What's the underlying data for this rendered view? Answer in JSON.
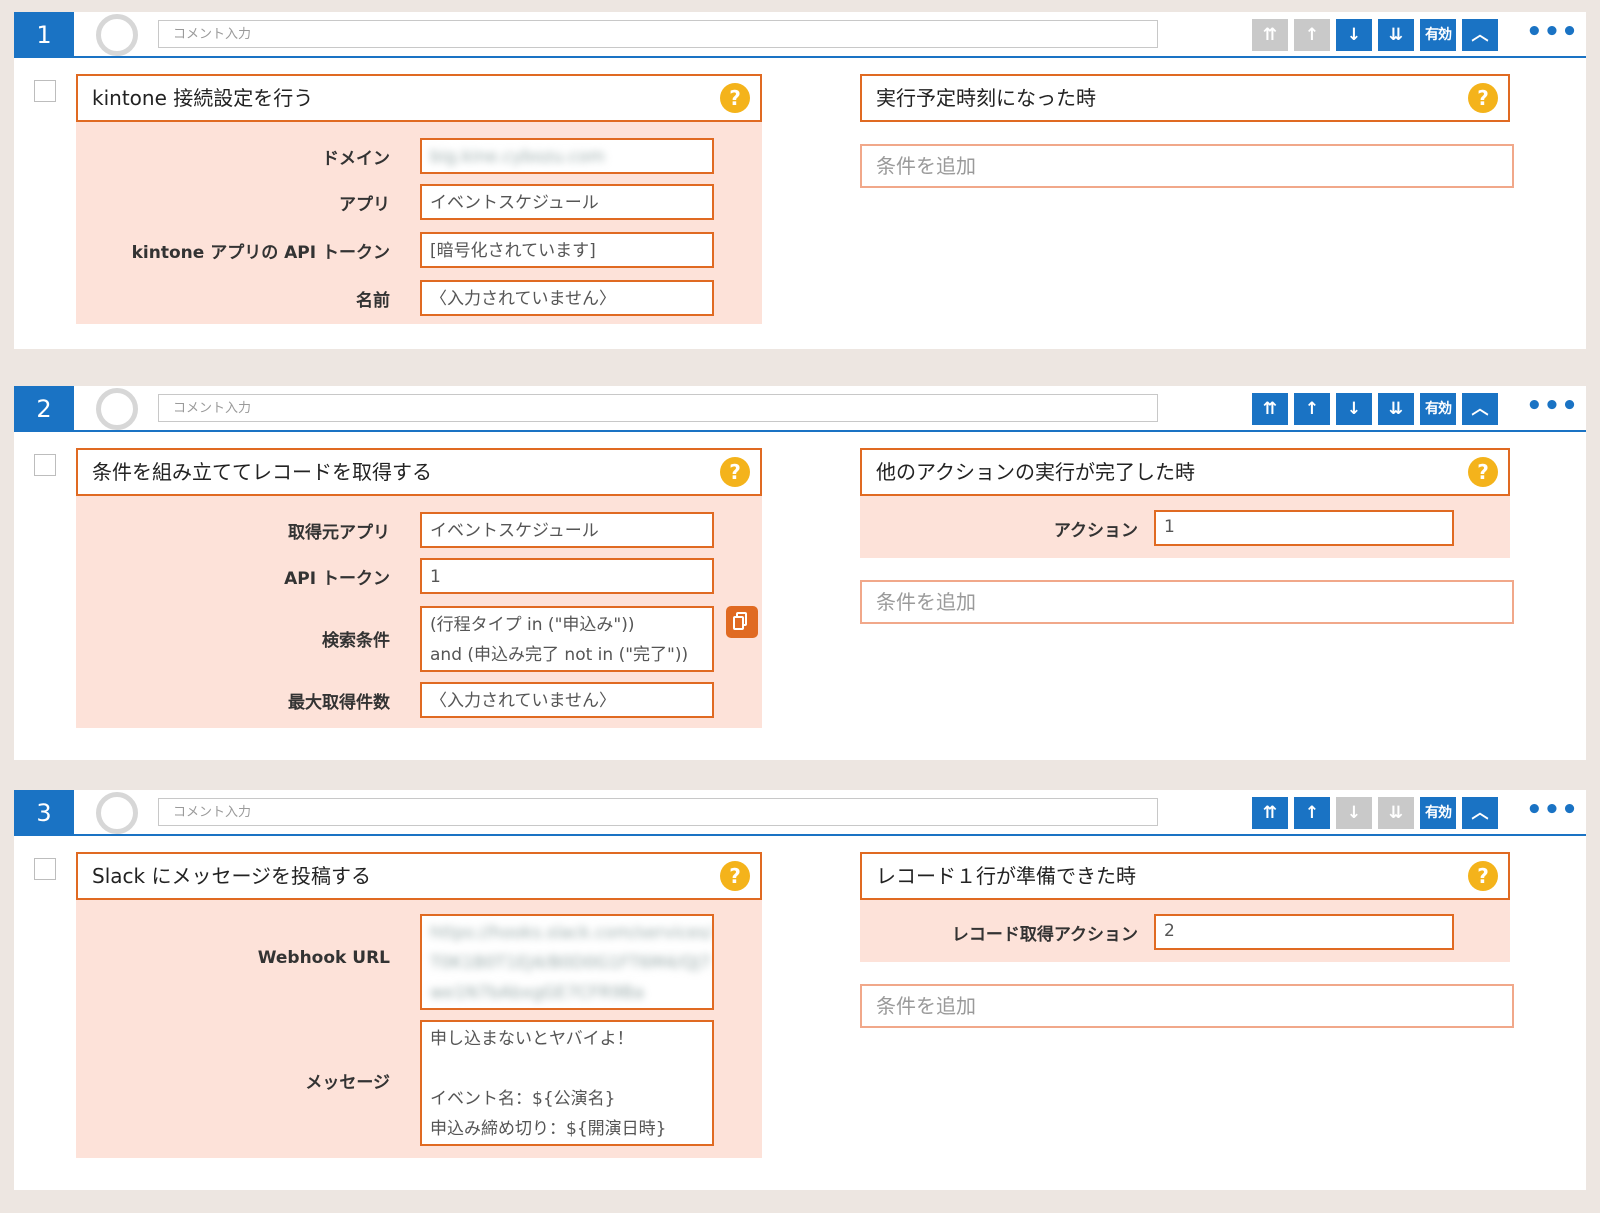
{
  "placeholder": "コメント入力",
  "toolbar_labels": {
    "enable": "有効"
  },
  "icons": {
    "top": "double-up-arrow-icon",
    "up": "up-arrow-icon",
    "down": "down-arrow-icon",
    "bottom": "double-down-arrow-icon",
    "collapse": "chevron-up-icon",
    "more": "more-dots-icon",
    "help": "question-icon",
    "copy": "copy-icon"
  },
  "colors": {
    "accent": "#1a73c4",
    "action": "#e06a22",
    "help": "#f4b31b",
    "panel_bg": "#fde2d9"
  },
  "jobs": [
    {
      "number": "1",
      "action_title": "kintone 接続設定を行う",
      "properties": [
        {
          "label": "ドメイン",
          "value": "big.kine.cybozu.com"
        },
        {
          "label": "アプリ",
          "value": "イベントスケジュール"
        },
        {
          "label": "kintone アプリの API トークン",
          "value": "[暗号化されています]"
        },
        {
          "label": "名前",
          "value": "〈入力されていません〉"
        }
      ],
      "trigger_title": "実行予定時刻になった時",
      "add_condition": "条件を追加"
    },
    {
      "number": "2",
      "action_title": "条件を組み立ててレコードを取得する",
      "properties": [
        {
          "label": "取得元アプリ",
          "value": "イベントスケジュール"
        },
        {
          "label": "API トークン",
          "value": "1"
        },
        {
          "label": "検索条件",
          "value": "(行程タイプ in (\"申込み\"))\nand (申込み完了 not in (\"完了\"))"
        },
        {
          "label": "最大取得件数",
          "value": "〈入力されていません〉"
        }
      ],
      "trigger_title": "他のアクションの実行が完了した時",
      "trigger_props": [
        {
          "label": "アクション",
          "value": "1"
        }
      ],
      "add_condition": "条件を追加"
    },
    {
      "number": "3",
      "action_title": "Slack にメッセージを投稿する",
      "properties": [
        {
          "label": "Webhook URL",
          "value": "https://hooks.slack.com/services/\nT0K1B0T1EJ4/B0D0G1FT6M4/QJ7\nwe1N7bAbxgGE7CFR9Ba"
        },
        {
          "label": "メッセージ",
          "value": "申し込まないとヤバイよ！\n\nイベント名：${公演名}\n申込み締め切り：${開演日時}"
        }
      ],
      "trigger_title": "レコード１行が準備できた時",
      "trigger_props": [
        {
          "label": "レコード取得アクション",
          "value": "2"
        }
      ],
      "add_condition": "条件を追加"
    }
  ]
}
